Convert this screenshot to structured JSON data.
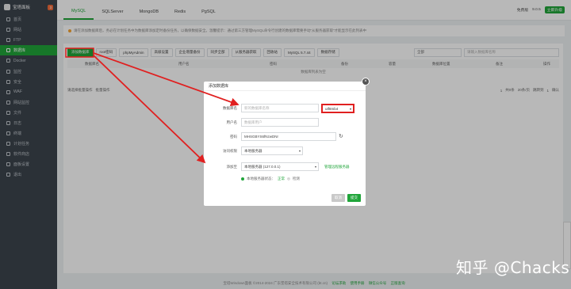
{
  "sidebar": {
    "brand": "宝塔面板",
    "badge": "3",
    "items": [
      {
        "label": "首页"
      },
      {
        "label": "网站"
      },
      {
        "label": "FTP"
      },
      {
        "label": "数据库",
        "active": true
      },
      {
        "label": "Docker"
      },
      {
        "label": "监控"
      },
      {
        "label": "安全"
      },
      {
        "label": "WAF"
      },
      {
        "label": "网站监控"
      },
      {
        "label": "文件"
      },
      {
        "label": "日志"
      },
      {
        "label": "终端"
      },
      {
        "label": "计划任务"
      },
      {
        "label": "软件商店"
      },
      {
        "label": "面板设置"
      },
      {
        "label": "退出"
      }
    ]
  },
  "tabs": [
    "MySQL",
    "SQLServer",
    "MongoDB",
    "Redis",
    "PgSQL"
  ],
  "topright": {
    "status": "免费版",
    "version": "9.0.5",
    "upgrade": "立即升级"
  },
  "notice": "请在添加数据库后，务必在计划任务中为数据库添加定时备份任务，以确保数据安全。温馨提示：通过第三方管理MySQL命令行创建的数据库需要手动“从服务器获取”才能显示在此列表中",
  "toolbar": {
    "buttons": [
      "添加数据库",
      "root密码",
      "phpMyAdmin",
      "高级设置",
      "企业增量备份",
      "同步全部",
      "从服务器获取",
      "回收站",
      "MySQL 5.7.44",
      "数据存储"
    ],
    "filter": "全部",
    "search_placeholder": "请输入数据库名称"
  },
  "table": {
    "headers": [
      "数据库名",
      "用户名",
      "密码",
      "备份",
      "容量",
      "数据库位置",
      "备注",
      "操作"
    ],
    "empty": "数据库列表为空",
    "batch": "请选择批量操作",
    "batch_btn": "批量操作",
    "pager": [
      "1",
      "共0条",
      "20条/页",
      "跳转到",
      "1",
      "确认"
    ]
  },
  "footer": {
    "copyright": "宝塔Windows面板 ©2014-2024 广东堡塔安全技术有限公司 (bt.cn)",
    "links": [
      "论坛求助",
      "使用手册",
      "微信公众号",
      "正版查询"
    ]
  },
  "dialog": {
    "title": "添加数据库",
    "close": "×",
    "fields": {
      "dbname_label": "数据库名",
      "dbname_placeholder": "新的数据库名称",
      "charset": "utf8mb4",
      "user_label": "用户名",
      "user_placeholder": "数据库用户",
      "pwd_label": "密码",
      "pwd_value": "MHSGBYS6fNzwDNr",
      "access_label": "访问权限",
      "access_value": "本地服务器",
      "addto_label": "添加至",
      "addto_value": "本地服务器 (127.0.0.1)",
      "manage_link": "管理远程服务器"
    },
    "status": {
      "text": "本地服务器状态：",
      "ok": "正常",
      "check": "检测"
    },
    "cancel": "取消",
    "submit": "提交"
  },
  "watermark": "知乎 @Chacks",
  "colors": {
    "accent": "#20a53a",
    "sidebar": "#3c444d",
    "annotation": "#e02020"
  }
}
